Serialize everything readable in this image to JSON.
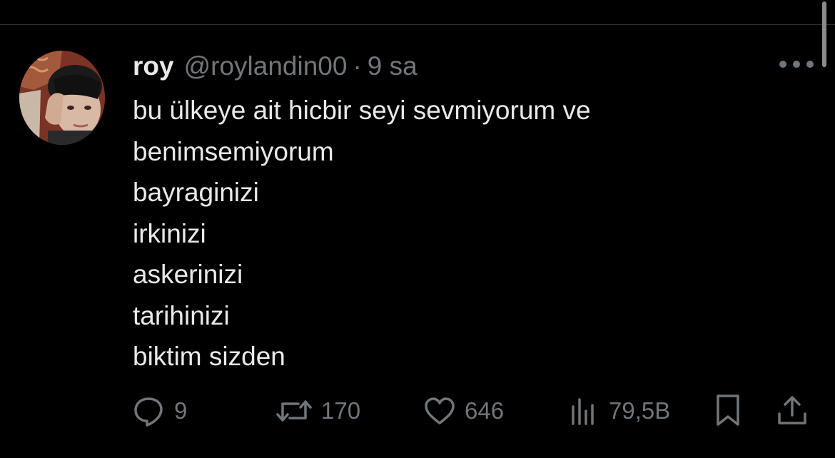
{
  "tweet": {
    "author": {
      "display_name": "roy",
      "handle": "@roylandin00"
    },
    "separator": "·",
    "timestamp": "9 sa",
    "text_lines": [
      "bu ülkeye ait hicbir seyi sevmiyorum ve",
      "benimsemiyorum",
      "bayraginizi",
      "irkinizi",
      "askerinizi",
      "tarihinizi",
      "biktim sizden"
    ]
  },
  "actions": {
    "replies": "9",
    "retweets": "170",
    "likes": "646",
    "views": "79,5B"
  },
  "icons": {
    "more": "more-horizontal-icon",
    "reply": "speech-bubble-icon",
    "retweet": "retweet-arrows-icon",
    "like": "heart-icon",
    "views": "bar-chart-icon",
    "bookmark": "bookmark-icon",
    "share": "share-upload-icon"
  },
  "colors": {
    "background": "#000000",
    "primary_text": "#e7e9ea",
    "secondary_text": "#71767b",
    "divider": "#2f3336"
  }
}
